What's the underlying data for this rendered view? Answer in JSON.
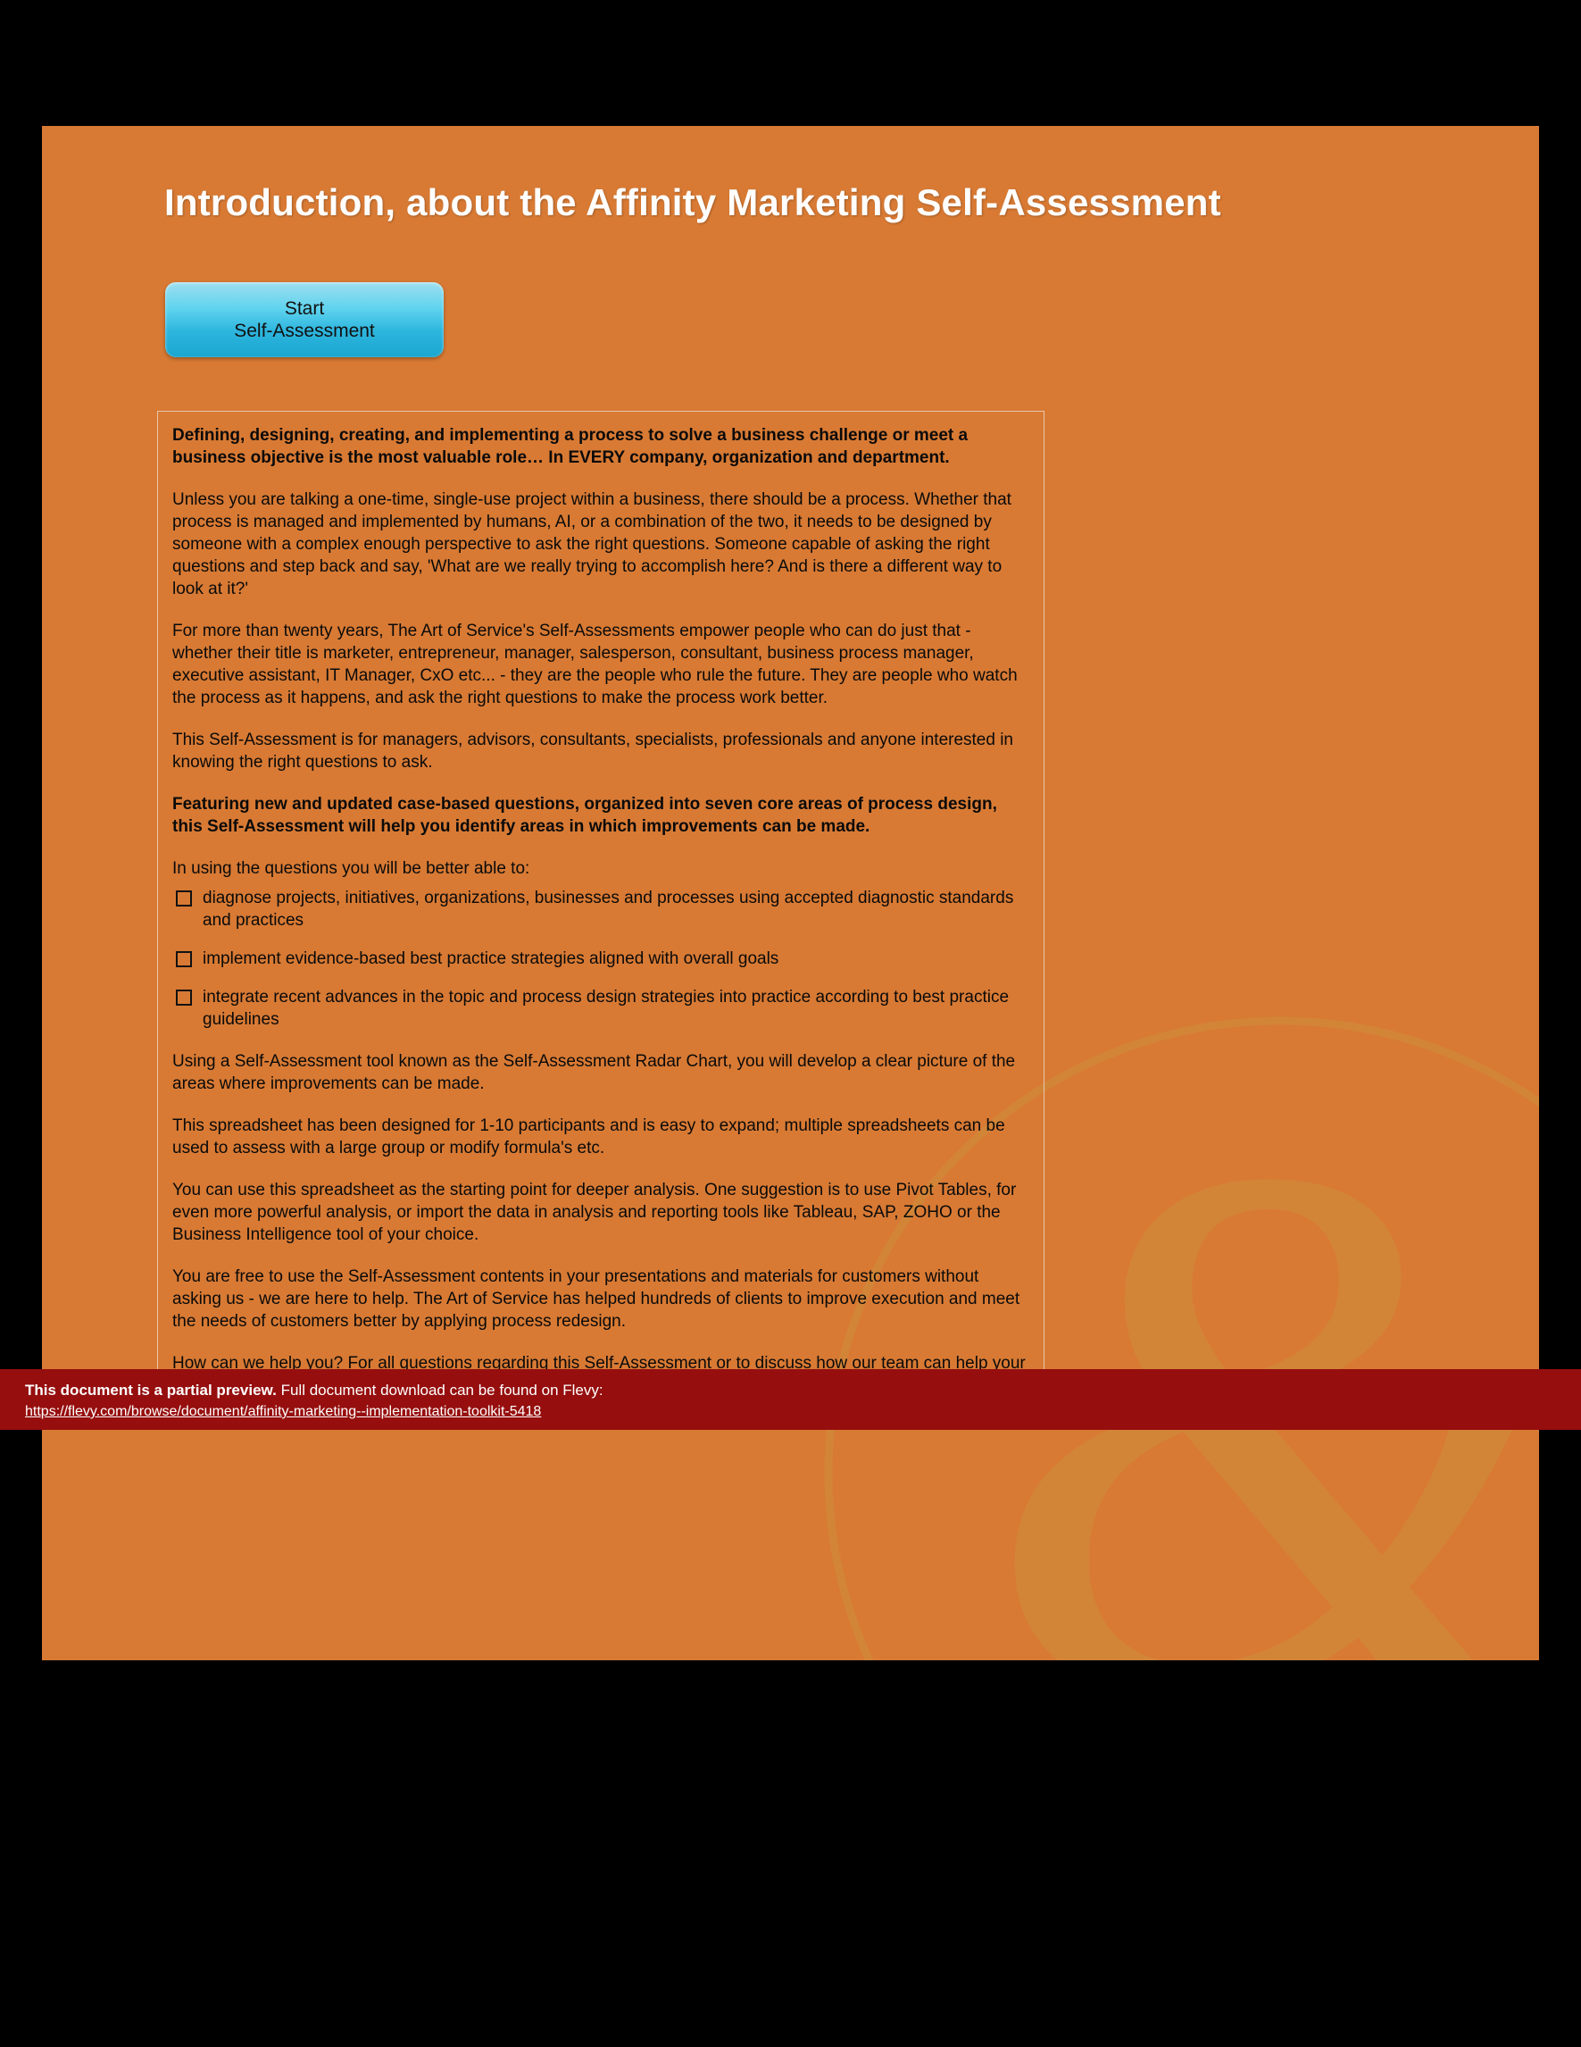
{
  "title": "Introduction, about the Affinity Marketing Self-Assessment",
  "start_button": {
    "line1": "Start",
    "line2": "Self-Assessment"
  },
  "content": {
    "p1_bold": "Defining, designing, creating, and implementing a process to solve a business challenge or meet a business objective is the most valuable role… In EVERY company, organization and department.",
    "p2": "Unless you are talking a one-time, single-use project within a business, there should be a process. Whether that process is managed and implemented by humans, AI, or a combination of the two, it needs to be designed by someone with a complex enough perspective to ask the right questions. Someone capable of asking the right questions and step back and say, 'What are we really trying to accomplish here? And is there a different way to look at it?'",
    "p3": "For more than twenty years, The Art of Service's Self-Assessments empower people who can do just that - whether their title is marketer, entrepreneur, manager, salesperson, consultant, business process manager, executive assistant, IT Manager, CxO etc... - they are the people who rule the future. They are people who watch the process as it happens, and ask the right questions to make the process work better.",
    "p4": "This Self-Assessment is for managers, advisors, consultants, specialists, professionals and anyone interested in knowing the right questions to ask.",
    "p5_bold": "Featuring new and updated case-based questions, organized into seven core areas of process design, this Self-Assessment will help you identify areas in which improvements can be made.",
    "p6_lead": "In using the questions you will be better able to:",
    "bullets": [
      "diagnose projects, initiatives, organizations, businesses and processes using accepted diagnostic standards and practices",
      "implement evidence-based best practice strategies aligned with overall goals",
      "integrate recent advances in the topic and process design strategies into practice according to best practice guidelines"
    ],
    "p7": "Using a Self-Assessment tool known as the Self-Assessment Radar Chart, you will develop a clear picture of the areas where improvements can be made.",
    "p8": "This spreadsheet has been designed for 1-10 participants and is easy to expand; multiple spreadsheets can be used to assess with a large group or modify formula's etc.",
    "p9": "You can use this spreadsheet as the starting point for deeper analysis. One suggestion is to use Pivot Tables, for even more powerful analysis, or import the data in analysis and reporting tools like Tableau, SAP, ZOHO or the Business Intelligence tool of your choice.",
    "p10": "You are free to use the Self-Assessment contents in your presentations and materials for customers without asking us - we are here to help. The Art of Service has helped hundreds of clients to improve execution and meet the needs of customers better by applying process redesign.",
    "p11": "How can we help you? For all questions regarding this Self-Assessment or to discuss how our team can help your business achieve true results, please visit"
  },
  "banner": {
    "bold": "This document is a partial preview.",
    "rest": "  Full document download can be found on Flevy:",
    "link": "https://flevy.com/browse/document/affinity-marketing--implementation-toolkit-5418"
  }
}
